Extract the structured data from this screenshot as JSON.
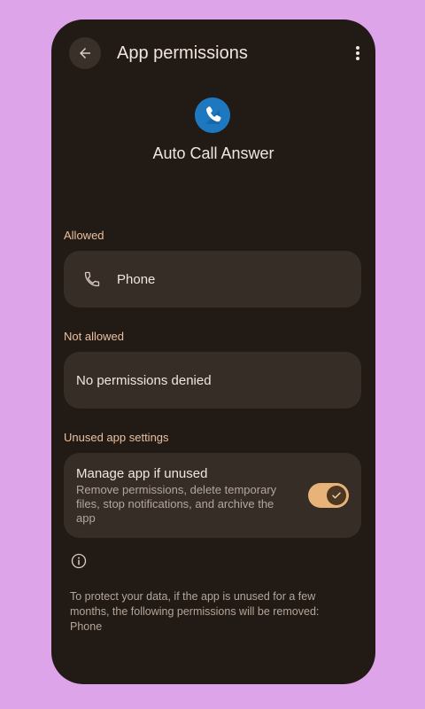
{
  "header": {
    "title": "App permissions",
    "back_icon": "arrow-left-icon",
    "more_icon": "more-vertical-icon"
  },
  "app": {
    "name": "Auto Call Answer",
    "icon": "phone-icon",
    "icon_color": "#1d78bf"
  },
  "sections": {
    "allowed_label": "Allowed",
    "allowed_items": [
      {
        "label": "Phone",
        "icon": "phone-icon"
      }
    ],
    "not_allowed_label": "Not allowed",
    "not_allowed_text": "No permissions denied",
    "unused_label": "Unused app settings"
  },
  "manage": {
    "title": "Manage app if unused",
    "description": "Remove permissions, delete temporary files, stop notifications, and archive the app",
    "toggle_on": true
  },
  "footer": {
    "info_icon": "info-icon",
    "text": "To protect your data, if the app is unused for a few months, the following permissions will be removed: Phone"
  },
  "colors": {
    "background": "#dea4ea",
    "surface": "#221a15",
    "card": "#362d27",
    "accent": "#e7b378",
    "section_label": "#e9c1a0"
  }
}
